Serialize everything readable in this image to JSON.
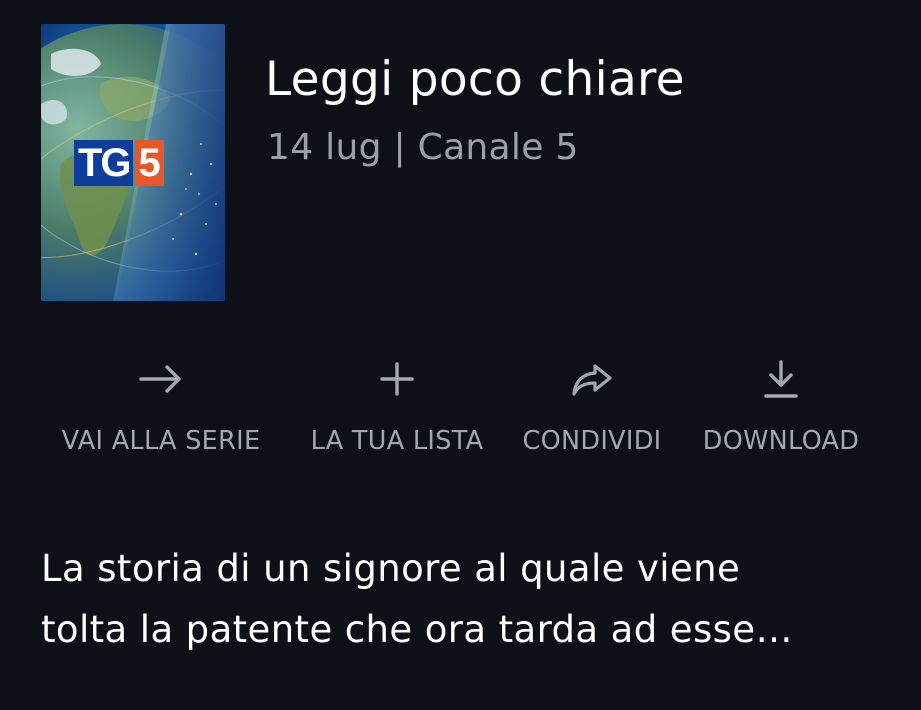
{
  "episode": {
    "poster_logo_tg": "TG",
    "poster_logo_5": "5",
    "title": "Leggi poco chiare",
    "meta": "14 lug | Canale 5"
  },
  "actions": [
    {
      "label": "VAI ALLA SERIE",
      "icon": "arrow-right-icon"
    },
    {
      "label": "LA TUA LISTA",
      "icon": "plus-icon"
    },
    {
      "label": "CONDIVIDI",
      "icon": "share-icon"
    },
    {
      "label": "DOWNLOAD",
      "icon": "download-icon"
    }
  ],
  "description": {
    "line1": "La storia di un signore al quale viene",
    "line2": "tolta la patente che ora tarda ad esse…"
  },
  "colors": {
    "background": "#0d1117",
    "title": "#ffffff",
    "meta": "#9aa0a6",
    "action_label": "#a3a8ad",
    "logo_blue": "#0f3d9c",
    "logo_orange": "#e8572a"
  }
}
